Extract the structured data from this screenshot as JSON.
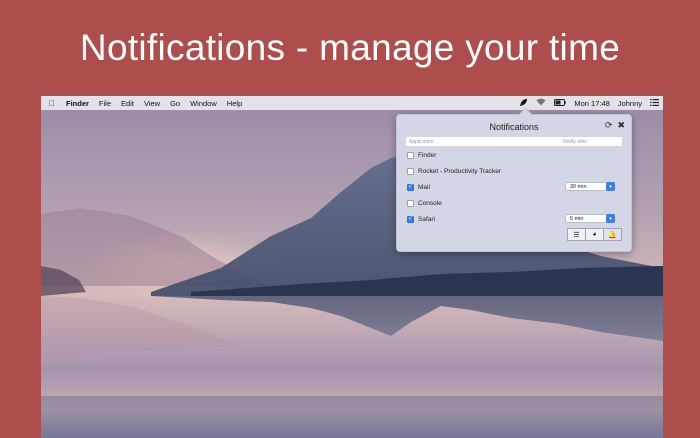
{
  "headline": "Notifications - manage your time",
  "menubar": {
    "apple_icon": "",
    "items": [
      "Finder",
      "File",
      "Edit",
      "View",
      "Go",
      "Window",
      "Help"
    ],
    "status": {
      "rocket_icon": "rocket-icon",
      "wifi_icon": "wifi-icon",
      "battery_icon": "battery-icon",
      "clock": "Mon 17:48",
      "user": "Johnny",
      "list_icon": "list-icon"
    }
  },
  "panel": {
    "title": "Notifications",
    "refresh_icon": "⟳",
    "close_icon": "✖",
    "columns": {
      "application": "Application",
      "notify_after": "Notify after"
    },
    "rows": [
      {
        "name": "Finder",
        "checked": false,
        "notify_after": null
      },
      {
        "name": "Rocket - Productivity Tracker",
        "checked": false,
        "notify_after": null
      },
      {
        "name": "Mail",
        "checked": true,
        "notify_after": "30 min"
      },
      {
        "name": "Console",
        "checked": false,
        "notify_after": null
      },
      {
        "name": "Safari",
        "checked": true,
        "notify_after": "5 min"
      }
    ],
    "views": {
      "list_icon": "☰",
      "pie_icon": "◕",
      "bell_icon": "🔔"
    }
  },
  "colors": {
    "background": "#ad4d4c",
    "accent": "#3d7fe0",
    "panel": "#d3d6e5"
  }
}
